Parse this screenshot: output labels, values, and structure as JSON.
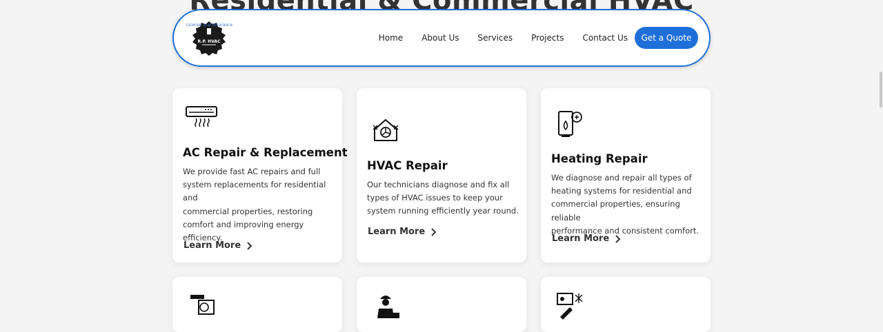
{
  "page": {
    "hero_heading": "Residential & Commercial HVAC"
  },
  "logo": {
    "tagline": "License and Insurance",
    "name": "R.P. HVAC"
  },
  "nav": {
    "links": [
      "Home",
      "About Us",
      "Services",
      "Projects",
      "Contact Us"
    ],
    "cta": "Get a Quote"
  },
  "cards": [
    {
      "icon": "air-conditioner-icon",
      "title": "AC Repair & Replacement",
      "description_lines": [
        "We provide fast AC repairs and full",
        "system replacements for residential and",
        "commercial properties, restoring",
        "comfort and improving energy",
        "efficiency."
      ],
      "link": "Learn More"
    },
    {
      "icon": "house-fan-snowflake-icon",
      "title": "HVAC Repair",
      "description_lines": [
        "Our technicians diagnose and fix all",
        "types of HVAC issues to keep your",
        "system running efficiently year round."
      ],
      "link": "Learn More"
    },
    {
      "icon": "heater-flame-wrench-icon",
      "title": "Heating Repair",
      "description_lines": [
        "We diagnose and repair all types of",
        "heating systems for residential and",
        "commercial properties, ensuring reliable",
        "performance and consistent comfort."
      ],
      "link": "Learn More"
    }
  ],
  "lower_cards_icons": [
    "outdoor-ac-unit-icon",
    "technician-icon",
    "thermostat-tools-icon"
  ],
  "colors": {
    "accent": "#1e6fd9",
    "background": "#f4f4f4",
    "card": "#ffffff"
  }
}
